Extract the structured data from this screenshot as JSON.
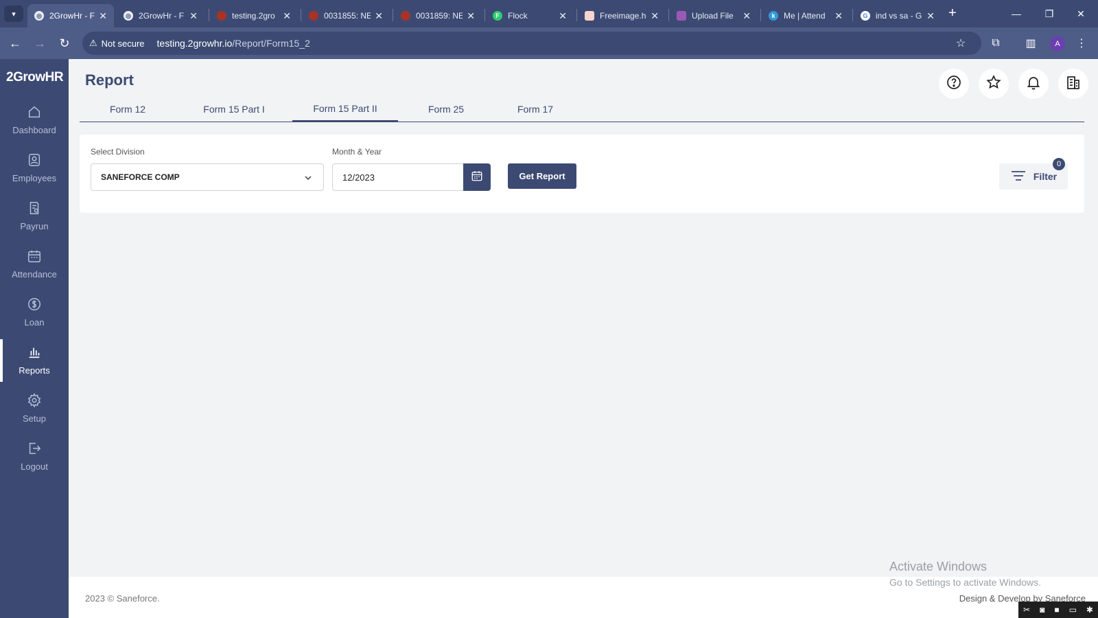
{
  "browser": {
    "tabs": [
      {
        "title": "2GrowHr - F",
        "active": true,
        "favicon": "globe-icon",
        "color": "#ffffff"
      },
      {
        "title": "2GrowHr - F",
        "active": false,
        "favicon": "globe-icon",
        "color": "#ffffff"
      },
      {
        "title": "testing.2gro",
        "active": false,
        "favicon": "saneforce-icon",
        "color": "#c0392b"
      },
      {
        "title": "0031855: NE",
        "active": false,
        "favicon": "saneforce-icon",
        "color": "#c0392b"
      },
      {
        "title": "0031859: NE",
        "active": false,
        "favicon": "saneforce-icon",
        "color": "#c0392b"
      },
      {
        "title": "Flock",
        "active": false,
        "favicon": "flock-icon",
        "color": "#2ecc71"
      },
      {
        "title": "Freeimage.h",
        "active": false,
        "favicon": "freeimage-icon",
        "color": "#e74c3c"
      },
      {
        "title": "Upload File",
        "active": false,
        "favicon": "upload-icon",
        "color": "#9b59b6"
      },
      {
        "title": "Me | Attend",
        "active": false,
        "favicon": "k-icon",
        "color": "#3498db"
      },
      {
        "title": "ind vs sa - G",
        "active": false,
        "favicon": "google-icon",
        "color": "#ffffff"
      }
    ],
    "security_label": "Not secure",
    "url_host": "testing.2growhr.io",
    "url_path": "/Report/Form15_2",
    "profile_initial": "A"
  },
  "sidebar": {
    "logo": "2GrowHR",
    "items": [
      {
        "label": "Dashboard",
        "icon": "home-icon"
      },
      {
        "label": "Employees",
        "icon": "person-icon"
      },
      {
        "label": "Payrun",
        "icon": "payrun-icon"
      },
      {
        "label": "Attendance",
        "icon": "calendar-icon"
      },
      {
        "label": "Loan",
        "icon": "loan-icon"
      },
      {
        "label": "Reports",
        "icon": "bar-chart-icon",
        "active": true
      },
      {
        "label": "Setup",
        "icon": "gear-icon"
      },
      {
        "label": "Logout",
        "icon": "logout-icon"
      }
    ]
  },
  "header": {
    "title": "Report"
  },
  "report_tabs": [
    {
      "label": "Form 12"
    },
    {
      "label": "Form 15 Part I"
    },
    {
      "label": "Form 15 Part II",
      "active": true
    },
    {
      "label": "Form 25"
    },
    {
      "label": "Form 17"
    }
  ],
  "filters": {
    "division_label": "Select Division",
    "division_value": "SANEFORCE COMP",
    "month_year_label": "Month & Year",
    "month_year_value": "12/2023",
    "get_report_label": "Get Report",
    "filter_label": "Filter",
    "filter_count": "0"
  },
  "footer": {
    "copyright": "2023 © Saneforce.",
    "credit": "Design & Develop by Saneforce"
  },
  "watermark": {
    "line1": "Activate Windows",
    "line2": "Go to Settings to activate Windows."
  },
  "colors": {
    "primary": "#3c4a73",
    "sidebar_text": "#b7bfd8",
    "background": "#f1f3f4"
  }
}
